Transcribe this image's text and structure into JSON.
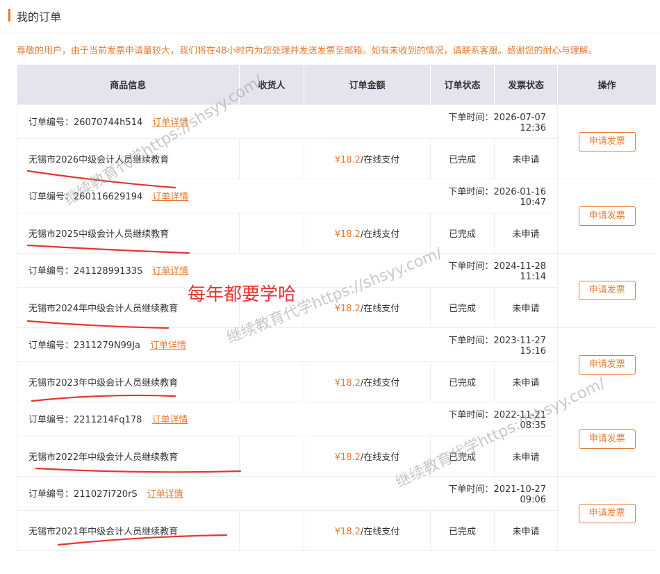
{
  "header": {
    "title": "我的订单"
  },
  "notice": "尊敬的用户，由于当前发票申请量较大，我们将在48小时内为您处理并发送发票至邮箱。如有未收到的情况，请联系客服。感谢您的耐心与理解。",
  "columns": {
    "product": "商品信息",
    "receiver": "收货人",
    "amount": "订单金额",
    "order_status": "订单状态",
    "invoice_status": "发票状态",
    "action": "操作"
  },
  "labels": {
    "order_no_prefix": "订单编号：",
    "order_time_prefix": "下单时间：",
    "detail_link": "订单详情",
    "apply_invoice": "申请发票"
  },
  "orders": [
    {
      "order_no": "26070744h514",
      "time": "2026-07-07 12:36",
      "product": "无锡市2026中级会计人员继续教育",
      "receiver": "",
      "price": "¥18.2",
      "pay": "/在线支付",
      "status": "已完成",
      "invoice": "未申请"
    },
    {
      "order_no": "260116629194",
      "time": "2026-01-16 10:47",
      "product": "无锡市2025中级会计人员继续教育",
      "receiver": "",
      "price": "¥18.2",
      "pay": "/在线支付",
      "status": "已完成",
      "invoice": "未申请"
    },
    {
      "order_no": "24112899133S",
      "time": "2024-11-28 11:14",
      "product": "无锡市2024年中级会计人员继续教育",
      "receiver": "",
      "price": "¥18.2",
      "pay": "/在线支付",
      "status": "已完成",
      "invoice": "未申请"
    },
    {
      "order_no": "2311279N99Ja",
      "time": "2023-11-27 15:16",
      "product": "无锡市2023年中级会计人员继续教育",
      "receiver": "",
      "price": "¥18.2",
      "pay": "/在线支付",
      "status": "已完成",
      "invoice": "未申请"
    },
    {
      "order_no": "2211214Fq178",
      "time": "2022-11-21 08:35",
      "product": "无锡市2022年中级会计人员继续教育",
      "receiver": "",
      "price": "¥18.2",
      "pay": "/在线支付",
      "status": "已完成",
      "invoice": "未申请"
    },
    {
      "order_no": "211027i720rS",
      "time": "2021-10-27 09:06",
      "product": "无锡市2021年中级会计人员继续教育",
      "receiver": "",
      "price": "¥18.2",
      "pay": "/在线支付",
      "status": "已完成",
      "invoice": "未申请"
    }
  ],
  "annotation": {
    "text": "每年都要学哈",
    "color": "#e8342e"
  },
  "watermarks": [
    "继续教育代学https://shsyy.com/",
    "继续教育代学https://shsyy.com/",
    "继续教育代学https://shsyy.com/"
  ],
  "colors": {
    "accent": "#e8792f",
    "header_bg": "#e4e4ef",
    "annotation_ink": "#e8342e",
    "watermark": "#9a9a9a"
  }
}
